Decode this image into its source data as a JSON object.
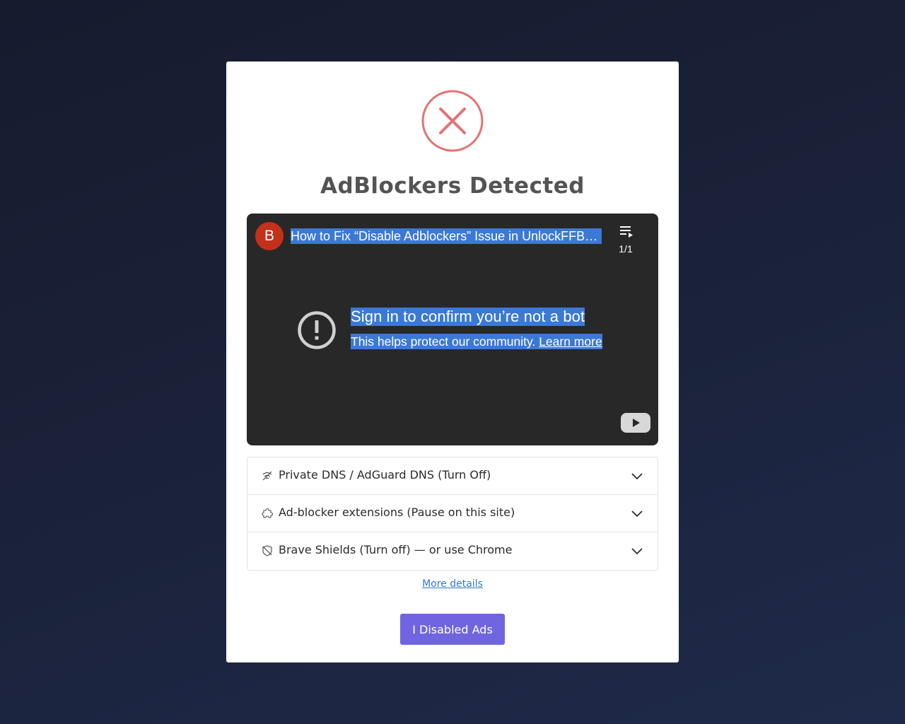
{
  "modal": {
    "title": "AdBlockers Detected",
    "error_color": "#e57373"
  },
  "video": {
    "channel_initial": "B",
    "title": "How to Fix “Disable Adblockers” Issue in UnlockFFBet…",
    "playlist_count": "1/1",
    "bot_heading": "Sign in to confirm you’re not a bot",
    "bot_sub": "This helps protect our community.",
    "learn_more": "Learn more"
  },
  "accordion": {
    "items": [
      {
        "label": "Private DNS / AdGuard DNS (Turn Off)",
        "icon": "wifi-off-icon"
      },
      {
        "label": "Ad-blocker extensions (Pause on this site)",
        "icon": "puzzle-icon"
      },
      {
        "label": "Brave Shields (Turn off) — or use Chrome",
        "icon": "shield-off-icon"
      }
    ]
  },
  "links": {
    "more_details": "More details"
  },
  "buttons": {
    "confirm": "I Disabled Ads",
    "confirm_color": "#7065e0"
  }
}
